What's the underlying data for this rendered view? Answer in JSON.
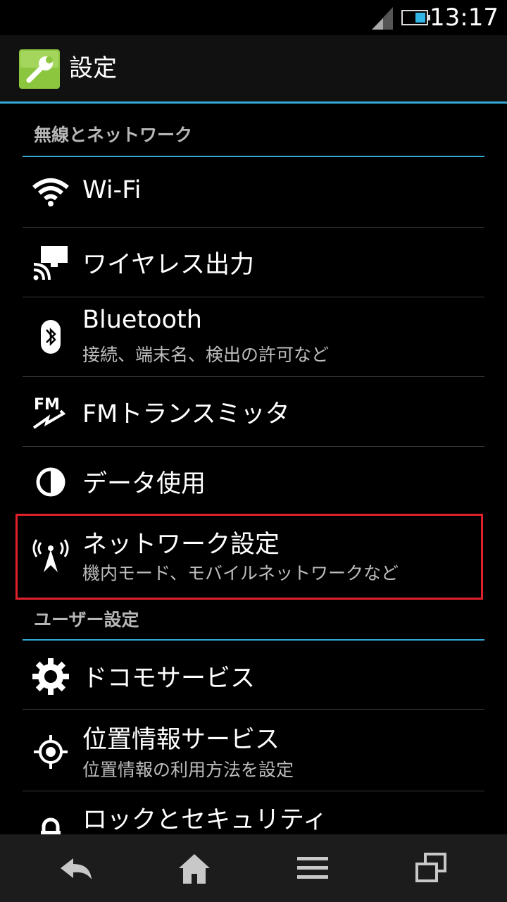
{
  "status": {
    "time": "13:17"
  },
  "header": {
    "title": "設定"
  },
  "sections": [
    {
      "label": "無線とネットワーク"
    },
    {
      "label": "ユーザー設定"
    }
  ],
  "items": [
    {
      "title": "Wi-Fi",
      "icon": "wifi-icon"
    },
    {
      "title": "ワイヤレス出力",
      "icon": "cast-icon"
    },
    {
      "title": "Bluetooth",
      "subtitle": "接続、端末名、検出の許可など",
      "icon": "bluetooth-icon"
    },
    {
      "title": "FMトランスミッタ",
      "icon": "fm-transmitter-icon"
    },
    {
      "title": "データ使用",
      "icon": "data-usage-icon"
    },
    {
      "title": "ネットワーク設定",
      "subtitle": "機内モード、モバイルネットワークなど",
      "icon": "antenna-icon"
    },
    {
      "title": "ドコモサービス",
      "icon": "gear-icon"
    },
    {
      "title": "位置情報サービス",
      "subtitle": "位置情報の利用方法を設定",
      "icon": "location-icon"
    },
    {
      "title": "ロックとセキュリティ",
      "icon": "lock-icon"
    }
  ],
  "navbar": {
    "icons": [
      "back-icon",
      "home-icon",
      "menu-icon",
      "recent-apps-icon"
    ]
  },
  "colors": {
    "accent": "#33a9d6",
    "highlight": "#e0202a",
    "app_icon": "#8cc63f"
  }
}
